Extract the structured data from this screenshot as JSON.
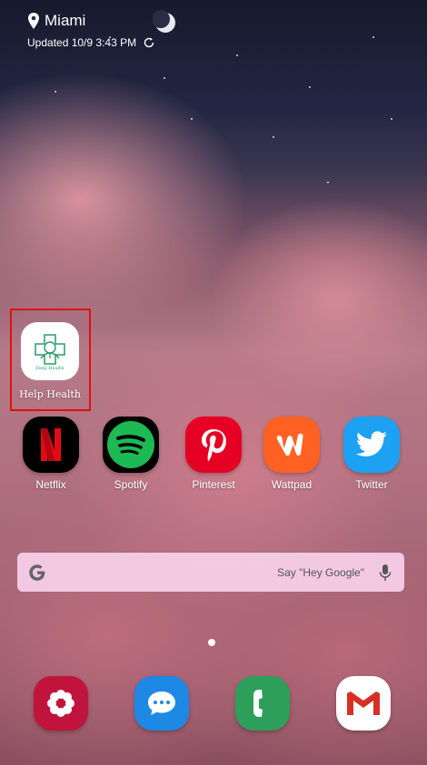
{
  "weather": {
    "city": "Miami",
    "updated": "Updated 10/9 3:43 PM"
  },
  "apps": {
    "help_health": {
      "label": "Help Health",
      "icon_text": "Help Health"
    },
    "netflix": {
      "label": "Netflix",
      "color": "#000000"
    },
    "spotify": {
      "label": "Spotify",
      "color": "#1db954"
    },
    "pinterest": {
      "label": "Pinterest",
      "color": "#e60023"
    },
    "wattpad": {
      "label": "Wattpad",
      "color": "#ff6122"
    },
    "twitter": {
      "label": "Twitter",
      "color": "#1da1f2"
    }
  },
  "search": {
    "hint": "Say \"Hey Google\""
  },
  "dock": {
    "blossom_color": "#c0143c",
    "messages_color": "#1e88e5",
    "phone_color": "#2e9f5b",
    "gmail_color": "#ffffff"
  }
}
